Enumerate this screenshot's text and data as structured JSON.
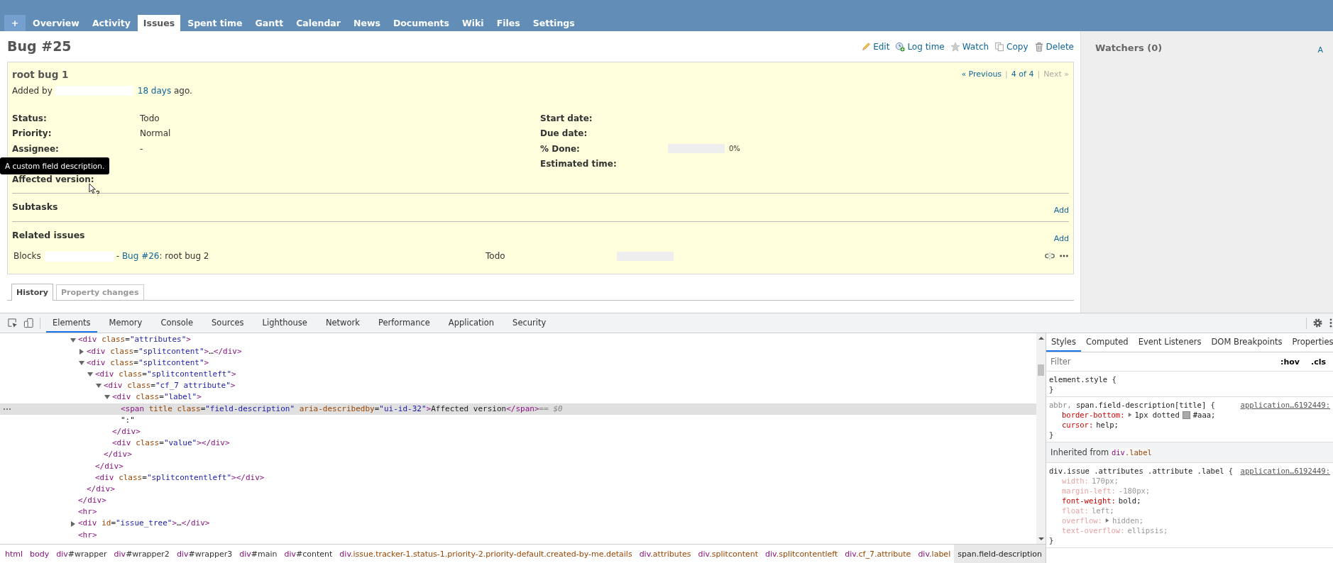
{
  "project_tabs": [
    {
      "label": "+",
      "kind": "new",
      "selected": false
    },
    {
      "label": "Overview",
      "kind": "tab",
      "selected": false
    },
    {
      "label": "Activity",
      "kind": "tab",
      "selected": false
    },
    {
      "label": "Issues",
      "kind": "tab",
      "selected": true
    },
    {
      "label": "Spent time",
      "kind": "tab",
      "selected": false
    },
    {
      "label": "Gantt",
      "kind": "tab",
      "selected": false
    },
    {
      "label": "Calendar",
      "kind": "tab",
      "selected": false
    },
    {
      "label": "News",
      "kind": "tab",
      "selected": false
    },
    {
      "label": "Documents",
      "kind": "tab",
      "selected": false
    },
    {
      "label": "Wiki",
      "kind": "tab",
      "selected": false
    },
    {
      "label": "Files",
      "kind": "tab",
      "selected": false
    },
    {
      "label": "Settings",
      "kind": "tab",
      "selected": false
    }
  ],
  "issue": {
    "heading": "Bug #25",
    "actions": [
      {
        "label": "Edit",
        "kind": "edit"
      },
      {
        "label": "Log time",
        "kind": "log-time"
      },
      {
        "label": "Watch",
        "kind": "watch"
      },
      {
        "label": "Copy",
        "kind": "copy"
      },
      {
        "label": "Delete",
        "kind": "delete"
      }
    ],
    "subject": "root bug 1",
    "nav": [
      {
        "kind": "link",
        "label": "« Previous",
        "disabled": false
      },
      {
        "kind": "separator",
        "label": "|"
      },
      {
        "kind": "link",
        "label": "4 of 4",
        "disabled": false
      },
      {
        "kind": "separator",
        "label": "|"
      },
      {
        "kind": "link",
        "label": "Next »",
        "disabled": true
      }
    ],
    "added_by": "Added by",
    "author_redacted": true,
    "age": "18 days",
    "ago": "ago.",
    "attributes_left": [
      {
        "label": "Status:",
        "value": "Todo"
      },
      {
        "label": "Priority:",
        "value": "Normal"
      },
      {
        "label": "Assignee:",
        "value": "-"
      }
    ],
    "attributes_right": [
      {
        "label": "Start date:",
        "kind": "text"
      },
      {
        "label": "Due date:",
        "kind": "text"
      },
      {
        "label": "% Done:",
        "kind": "progress",
        "level": 0,
        "reading": "0%"
      },
      {
        "label": "Estimated time:",
        "kind": "text"
      }
    ],
    "custom_fields": [
      {
        "label": "Affected version:"
      }
    ],
    "tooltip": "A custom field description.",
    "subtasks": {
      "title": "Subtasks",
      "add": "Add"
    },
    "related": {
      "title": "Related issues",
      "add": "Add",
      "rows": [
        {
          "relation": "Blocks",
          "issue_redacted": true,
          "dash": "- ",
          "link": "Bug #26",
          "subject": ": root bug 2",
          "status": "Todo",
          "level": 0
        }
      ]
    },
    "history_tabs": [
      {
        "label": "History",
        "selected": true
      },
      {
        "label": "Property changes",
        "selected": false
      }
    ]
  },
  "sidebar": {
    "title": "Watchers (0)",
    "link": "A"
  },
  "devtools": {
    "tabs": [
      {
        "label": "Elements",
        "selected": true
      },
      {
        "label": "Memory",
        "selected": false
      },
      {
        "label": "Console",
        "selected": false
      },
      {
        "label": "Sources",
        "selected": false
      },
      {
        "label": "Lighthouse",
        "selected": false
      },
      {
        "label": "Network",
        "selected": false
      },
      {
        "label": "Performance",
        "selected": false
      },
      {
        "label": "Application",
        "selected": false
      },
      {
        "label": "Security",
        "selected": false
      }
    ],
    "tree": [
      {
        "markup": "<div class=\"attributes\">",
        "expanded": true,
        "selected": false,
        "close": "</div>",
        "children": [
          {
            "markup": "<div class=\"splitcontent\">…</div>",
            "expanded": false,
            "selected": false
          },
          {
            "markup": "<div class=\"splitcontent\">",
            "expanded": true,
            "selected": false,
            "close": "</div>",
            "children": [
              {
                "markup": "<div class=\"splitcontentleft\">",
                "expanded": true,
                "selected": false,
                "close": "</div>",
                "children": [
                  {
                    "markup": "<div class=\"cf_7 attribute\">",
                    "expanded": true,
                    "selected": false,
                    "close": "</div>",
                    "children": [
                      {
                        "markup": "<div class=\"label\">",
                        "expanded": true,
                        "selected": false,
                        "close": "</div>",
                        "children": [
                          {
                            "markup": "<span title class=\"field-description\" aria-describedby=\"ui-id-32\">Affected version</span>",
                            "selected": true,
                            "suffix": "== $0"
                          },
                          {
                            "markup": "\":\"",
                            "selected": false
                          }
                        ]
                      },
                      {
                        "markup": "<div class=\"value\"></div>",
                        "selected": false
                      }
                    ]
                  }
                ]
              },
              {
                "markup": "<div class=\"splitcontentleft\"></div>",
                "selected": false
              }
            ]
          }
        ]
      },
      {
        "markup": "<hr>",
        "selected": false
      },
      {
        "markup": "<div id=\"issue_tree\">…</div>",
        "expanded": false,
        "selected": false
      },
      {
        "markup": "<hr>",
        "selected": false
      }
    ],
    "breadcrumbs": [
      {
        "label": "html",
        "selected": false
      },
      {
        "label": "body",
        "selected": false
      },
      {
        "label": "div#wrapper",
        "selected": false
      },
      {
        "label": "div#wrapper2",
        "selected": false
      },
      {
        "label": "div#wrapper3",
        "selected": false
      },
      {
        "label": "div#main",
        "selected": false
      },
      {
        "label": "div#content",
        "selected": false
      },
      {
        "label": "div.issue.tracker-1.status-1.priority-2.priority-default.created-by-me.details",
        "selected": false
      },
      {
        "label": "div.attributes",
        "selected": false
      },
      {
        "label": "div.splitcontent",
        "selected": false
      },
      {
        "label": "div.splitcontentleft",
        "selected": false
      },
      {
        "label": "div.cf_7.attribute",
        "selected": false
      },
      {
        "label": "div.label",
        "selected": false
      },
      {
        "label": "span.field-description",
        "selected": true
      }
    ],
    "style_tabs": [
      {
        "label": "Styles",
        "selected": true
      },
      {
        "label": "Computed",
        "selected": false
      },
      {
        "label": "Event Listeners",
        "selected": false
      },
      {
        "label": "DOM Breakpoints",
        "selected": false
      },
      {
        "label": "Properties",
        "selected": false
      }
    ],
    "filter_placeholder": "Filter",
    "filter_buttons": [
      ":hov",
      ".cls"
    ],
    "rules": [
      {
        "kind": "rule",
        "selector": [
          {
            "text": "element.style",
            "matched": true
          }
        ],
        "open": "{",
        "close": "}"
      },
      {
        "kind": "rule",
        "selector": [
          {
            "text": "abbr, ",
            "matched": false
          },
          {
            "text": "span.field-description[title]",
            "matched": true
          }
        ],
        "open": "{",
        "close": "}",
        "source": "application…6192449:",
        "properties": [
          {
            "name": "border-bottom:",
            "value": "1px dotted",
            "color": "#aaaaaa",
            "color_text": "#aaa;",
            "active": true,
            "expandable": true
          },
          {
            "name": "cursor:",
            "value": "help;",
            "active": true,
            "expandable": false
          }
        ]
      },
      {
        "kind": "inherited",
        "prefix": "Inherited from",
        "from": "div.label"
      },
      {
        "kind": "rule",
        "selector": [
          {
            "text": "div.issue .attributes .attribute .label",
            "matched": true
          }
        ],
        "open": "{",
        "close": "}",
        "source": "application…6192449:",
        "properties": [
          {
            "name": "width:",
            "value": "170px;",
            "active": false,
            "expandable": false
          },
          {
            "name": "margin-left:",
            "value": "-180px;",
            "active": false,
            "expandable": false
          },
          {
            "name": "font-weight:",
            "value": "bold;",
            "active": true,
            "expandable": false
          },
          {
            "name": "float:",
            "value": "left;",
            "active": false,
            "expandable": false
          },
          {
            "name": "overflow:",
            "value": "hidden;",
            "active": false,
            "expandable": true
          },
          {
            "name": "text-overflow:",
            "value": "ellipsis;",
            "active": false,
            "expandable": false
          }
        ]
      }
    ]
  }
}
